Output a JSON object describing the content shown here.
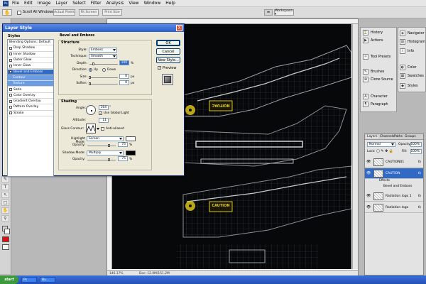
{
  "menu": {
    "app_icon": "Ps",
    "items": [
      "File",
      "Edit",
      "Image",
      "Layer",
      "Select",
      "Filter",
      "Analysis",
      "View",
      "Window",
      "Help"
    ]
  },
  "options_bar": {
    "scroll_all_windows": "Scroll All Windows",
    "actual_pixels": "Actual Pixels",
    "fit_screen": "Fit Screen",
    "print_size": "Print Size",
    "workspace": "Workspace ▾"
  },
  "dialog": {
    "title": "Layer Style",
    "close": "X",
    "styles_header": "Styles",
    "style_items": [
      "Blending Options: Default",
      "Drop Shadow",
      "Inner Shadow",
      "Outer Glow",
      "Inner Glow",
      "Bevel and Emboss",
      "Contour",
      "Texture",
      "Satin",
      "Color Overlay",
      "Gradient Overlay",
      "Pattern Overlay",
      "Stroke"
    ],
    "bevel_title": "Bevel and Emboss",
    "structure_title": "Structure",
    "style_label": "Style:",
    "style_value": "Emboss",
    "technique_label": "Technique:",
    "technique_value": "Smooth",
    "depth_label": "Depth:",
    "depth_value": "100",
    "depth_unit": "%",
    "direction_label": "Direction:",
    "dir_up": "Up",
    "dir_down": "Down",
    "size_label": "Size:",
    "size_value": "0",
    "size_unit": "px",
    "soften_label": "Soften:",
    "soften_value": "0",
    "soften_unit": "px",
    "shading_title": "Shading",
    "angle_label": "Angle:",
    "angle_value": "164",
    "angle_unit": "°",
    "global_light": "Use Global Light",
    "altitude_label": "Altitude:",
    "altitude_value": "11",
    "altitude_unit": "°",
    "gloss_label": "Gloss Contour:",
    "anti_aliased": "Anti-aliased",
    "highlight_label": "Highlight Mode:",
    "highlight_value": "Screen",
    "hl_opacity_label": "Opacity:",
    "hl_opacity_value": "75",
    "hl_opacity_unit": "%",
    "shadow_label": "Shadow Mode:",
    "shadow_value": "Multiply",
    "sh_opacity_label": "Opacity:",
    "sh_opacity_value": "75",
    "sh_opacity_unit": "%",
    "ok": "OK",
    "cancel": "Cancel",
    "new_style": "New Style...",
    "preview": "Preview"
  },
  "panels": {
    "left_col": [
      "History",
      "Actions",
      "Tool Presets",
      "Brushes",
      "Clone Source",
      "Character",
      "Paragraph"
    ],
    "right_col": [
      "Navigator",
      "Histogram",
      "Info",
      "Color",
      "Swatches",
      "Styles"
    ]
  },
  "layers": {
    "tabs": [
      "Layers",
      "Channels",
      "Paths",
      "Groups"
    ],
    "blend_mode": "Normal",
    "opacity_label": "Opacity:",
    "opacity_value": "100%",
    "lock_label": "Lock:",
    "fill_label": "Fill:",
    "fill_value": "100%",
    "rows": [
      "CAUTION01",
      "CAUTION"
    ],
    "effects_label": "Effects",
    "effect_item": "Bevel and Emboss",
    "rows2": [
      "Radiation logo 1",
      "Radiation logo"
    ],
    "fx": "fx"
  },
  "artwork": {
    "sign_text": "CAUTION",
    "sign_text_mirrored": "NOITUAC"
  },
  "status": {
    "zoom": "146.17%",
    "doc": "Doc: 12.0M/151.2M"
  },
  "taskbar": {
    "start": "start",
    "task1": "Ps",
    "task2": "Bu..."
  },
  "colors": {
    "fg": "#000000",
    "bg": "#ffffff",
    "swatch_red": "#dd1111",
    "caution_yellow": "#d8c21a",
    "selected_blue": "#316ac5"
  }
}
